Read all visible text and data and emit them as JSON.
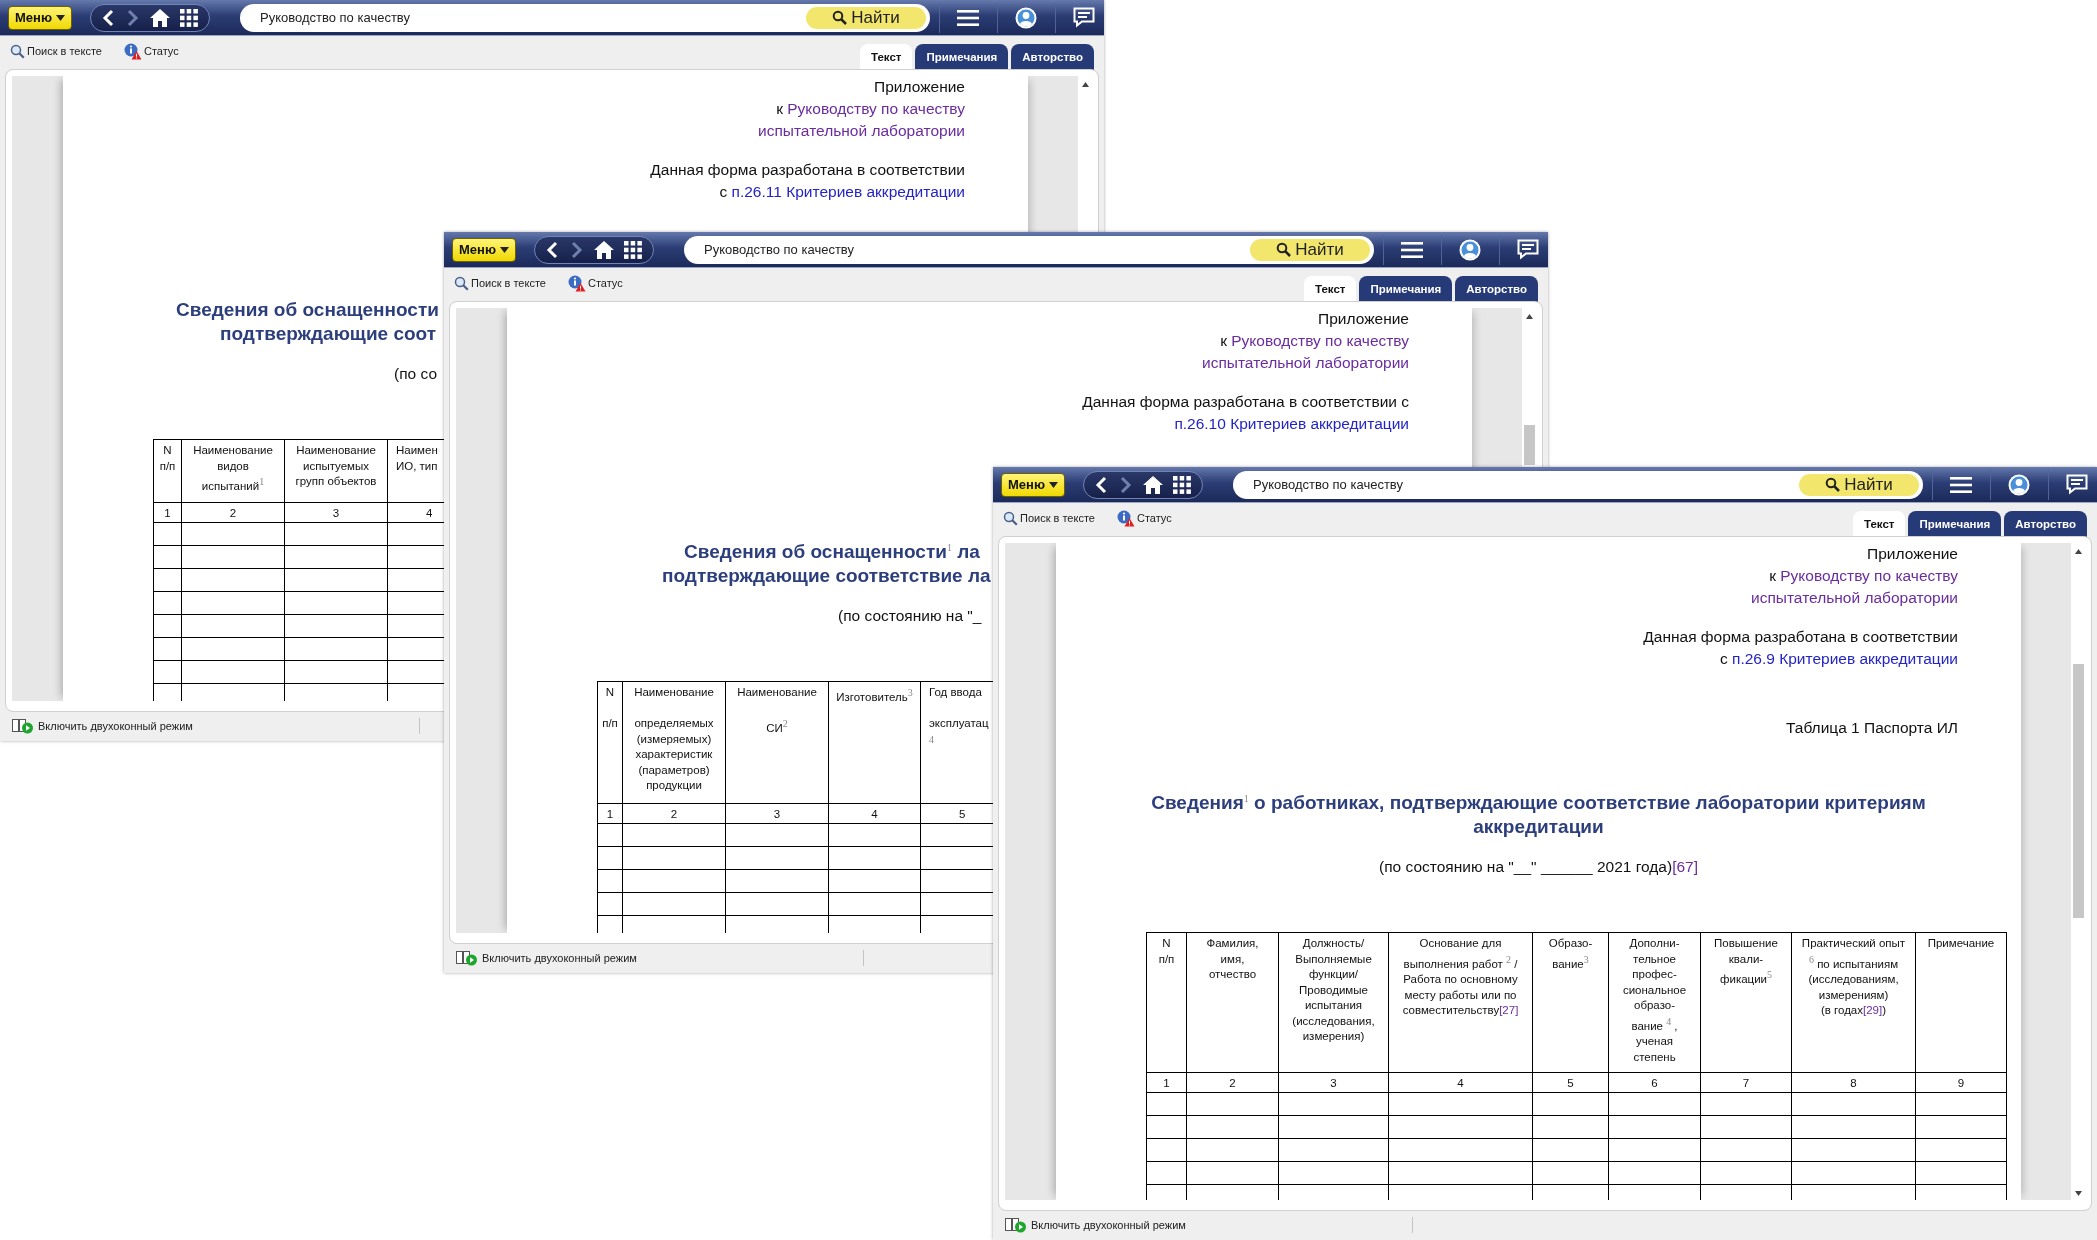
{
  "windows": [
    {
      "toolbar": {
        "menu_button": "Меню",
        "search_value": "Руководство по качеству",
        "find_button": "Найти"
      },
      "subbar": {
        "search_in_text": "Поиск в тексте",
        "status": "Статус"
      },
      "tabs": [
        {
          "label": "Текст",
          "selected": true
        },
        {
          "label": "Примечания",
          "selected": false
        },
        {
          "label": "Авторство",
          "selected": false
        }
      ],
      "document": {
        "blocks": [
          {
            "kind": "appendix",
            "lines": [
              [
                {
                  "text": "Приложение",
                  "kind": "text"
                }
              ],
              [
                {
                  "text": "к ",
                  "kind": "text"
                },
                {
                  "text": "Руководству по качеству",
                  "kind": "visited"
                }
              ],
              [
                {
                  "text": "испытательной лаборатории",
                  "kind": "visited"
                }
              ]
            ]
          },
          {
            "kind": "note",
            "lines": [
              [
                {
                  "text": "Данная форма разработана в соответствии",
                  "kind": "text"
                }
              ],
              [
                {
                  "text": "с ",
                  "kind": "text"
                },
                {
                  "text": "п.26.11 Критериев аккредитации",
                  "kind": "link"
                }
              ]
            ]
          },
          {
            "kind": "title",
            "lines": [
              [
                {
                  "text": "Сведения об оснащенности",
                  "kind": "text"
                }
              ],
              [
                {
                  "text": "подтверждающие соот",
                  "kind": "text"
                }
              ]
            ]
          },
          {
            "kind": "date",
            "lines": [
              [
                {
                  "text": "(по со",
                  "kind": "text"
                }
              ]
            ]
          }
        ],
        "table": {
          "headers": [
            "N\nп/п",
            [
              {
                "text": "Наименование\nвидов\nиспытаний",
                "kind": "text"
              },
              {
                "text": "1",
                "kind": "sup"
              }
            ],
            "Наименование\nиспытуемых\nгрупп объектов",
            "Наимен\nИО, тип"
          ],
          "numbers": [
            "1",
            "2",
            "3",
            "4"
          ]
        }
      },
      "status_bar": "Включить двухоконный режим"
    },
    {
      "toolbar": {
        "menu_button": "Меню",
        "search_value": "Руководство по качеству",
        "find_button": "Найти"
      },
      "subbar": {
        "search_in_text": "Поиск в тексте",
        "status": "Статус"
      },
      "tabs": [
        {
          "label": "Текст",
          "selected": true
        },
        {
          "label": "Примечания",
          "selected": false
        },
        {
          "label": "Авторство",
          "selected": false
        }
      ],
      "document": {
        "blocks": [
          {
            "kind": "appendix",
            "lines": [
              [
                {
                  "text": "Приложение",
                  "kind": "text"
                }
              ],
              [
                {
                  "text": "к ",
                  "kind": "text"
                },
                {
                  "text": "Руководству по качеству",
                  "kind": "visited"
                }
              ],
              [
                {
                  "text": "испытательной лаборатории",
                  "kind": "visited"
                }
              ]
            ]
          },
          {
            "kind": "note",
            "lines": [
              [
                {
                  "text": "Данная форма разработана в соответствии с",
                  "kind": "text"
                }
              ],
              [
                {
                  "text": "п.26.10 Критериев аккредитации",
                  "kind": "link"
                }
              ]
            ]
          },
          {
            "kind": "title",
            "lines": [
              [
                {
                  "text": "Сведения об оснащенности",
                  "kind": "text"
                },
                {
                  "text": "1",
                  "kind": "sup"
                },
                {
                  "text": " ла",
                  "kind": "text"
                }
              ],
              [
                {
                  "text": "подтверждающие соответствие ла",
                  "kind": "text"
                }
              ]
            ]
          },
          {
            "kind": "date",
            "lines": [
              [
                {
                  "text": "(по состоянию на \"_",
                  "kind": "text"
                }
              ]
            ]
          }
        ],
        "table": {
          "headers": [
            "N\n\nп/п",
            "Наименование\n\nопределяемых\n(измеряемых)\nхарактеристик\n(параметров)\nпродукции",
            [
              {
                "text": "Наименование\n\nСИ",
                "kind": "text"
              },
              {
                "text": "2",
                "kind": "sup"
              }
            ],
            [
              {
                "text": "Изготовитель",
                "kind": "text"
              },
              {
                "text": "3",
                "kind": "sup"
              }
            ],
            [
              {
                "text": "Год ввода\n\nэксплуатац\n",
                "kind": "text"
              },
              {
                "text": "4",
                "kind": "sup"
              }
            ]
          ],
          "numbers": [
            "1",
            "2",
            "3",
            "4",
            "5"
          ]
        }
      },
      "status_bar": "Включить двухоконный режим"
    },
    {
      "toolbar": {
        "menu_button": "Меню",
        "search_value": "Руководство по качеству",
        "find_button": "Найти"
      },
      "subbar": {
        "search_in_text": "Поиск в тексте",
        "status": "Статус"
      },
      "tabs": [
        {
          "label": "Текст",
          "selected": true
        },
        {
          "label": "Примечания",
          "selected": false
        },
        {
          "label": "Авторство",
          "selected": false
        }
      ],
      "document": {
        "blocks": [
          {
            "kind": "appendix",
            "lines": [
              [
                {
                  "text": "Приложение",
                  "kind": "text"
                }
              ],
              [
                {
                  "text": "к ",
                  "kind": "text"
                },
                {
                  "text": "Руководству по качеству",
                  "kind": "visited"
                }
              ],
              [
                {
                  "text": "испытательной лаборатории",
                  "kind": "visited"
                }
              ]
            ]
          },
          {
            "kind": "note",
            "lines": [
              [
                {
                  "text": "Данная форма разработана в соответствии",
                  "kind": "text"
                }
              ],
              [
                {
                  "text": "с ",
                  "kind": "text"
                },
                {
                  "text": "п.26.9 Критериев аккредитации",
                  "kind": "link"
                }
              ]
            ]
          },
          {
            "kind": "caption",
            "lines": [
              [
                {
                  "text": "Таблица 1 Паспорта ИЛ",
                  "kind": "text"
                }
              ]
            ]
          },
          {
            "kind": "title",
            "lines": [
              [
                {
                  "text": "Сведения",
                  "kind": "text"
                },
                {
                  "text": "1",
                  "kind": "sup"
                },
                {
                  "text": " о работниках, подтверждающие соответствие лаборатории критериям",
                  "kind": "text"
                }
              ],
              [
                {
                  "text": "аккредитации",
                  "kind": "text"
                }
              ]
            ]
          },
          {
            "kind": "date",
            "lines": [
              [
                {
                  "text": "(по состоянию на \"__\" ______ 2021 года)",
                  "kind": "text"
                },
                {
                  "text": "[67]",
                  "kind": "visited"
                }
              ]
            ]
          }
        ],
        "table": {
          "headers": [
            "N\nп/п",
            "Фамилия,\nимя,\nотчество",
            "Должность/\nВыполняемые\nфункции/\nПроводимые\nиспытания\n(исследования,\nизмерения)",
            [
              {
                "text": "Основание для\nвыполнения работ ",
                "kind": "text"
              },
              {
                "text": "2",
                "kind": "sup"
              },
              {
                "text": " /\nРабота по основному\nместу работы или по\nсовместительству",
                "kind": "text"
              },
              {
                "text": "[27]",
                "kind": "visited"
              }
            ],
            [
              {
                "text": "Образо-\nвание",
                "kind": "text"
              },
              {
                "text": "3",
                "kind": "sup"
              }
            ],
            [
              {
                "text": "Дополни-\nтельное\nпрофес-\nсиональное\nобразо-\nвание ",
                "kind": "text"
              },
              {
                "text": "4",
                "kind": "sup"
              },
              {
                "text": " ,\nученая\nстепень",
                "kind": "text"
              }
            ],
            [
              {
                "text": "Повышение\nквали-\nфикации",
                "kind": "text"
              },
              {
                "text": "5",
                "kind": "sup"
              }
            ],
            [
              {
                "text": "Практический опыт\n",
                "kind": "text"
              },
              {
                "text": "6",
                "kind": "sup"
              },
              {
                "text": "  по испытаниям\n(исследованиям,\nизмерениям)\n(в годах",
                "kind": "text"
              },
              {
                "text": "[29]",
                "kind": "visited"
              },
              {
                "text": ")",
                "kind": "text"
              }
            ],
            "Примечание"
          ],
          "numbers": [
            "1",
            "2",
            "3",
            "4",
            "5",
            "6",
            "7",
            "8",
            "9"
          ]
        }
      },
      "status_bar": "Включить двухоконный режим"
    }
  ]
}
